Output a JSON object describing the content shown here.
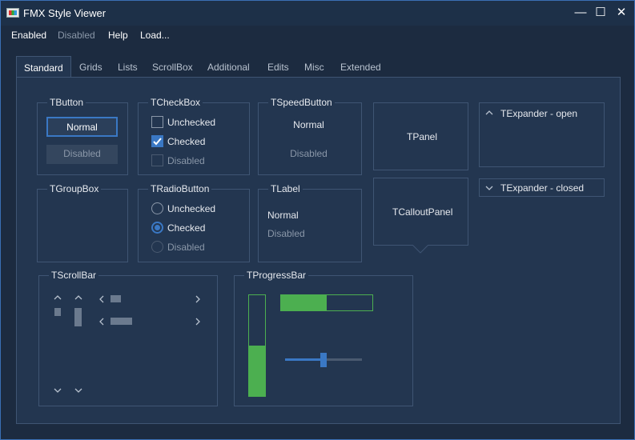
{
  "window": {
    "title": "FMX Style Viewer",
    "minimize": "—",
    "maximize": "☐",
    "close": "✕"
  },
  "menu": {
    "enabled": "Enabled",
    "disabled": "Disabled",
    "help": "Help",
    "load": "Load..."
  },
  "tabs": [
    "Standard",
    "Grids",
    "Lists",
    "ScrollBox",
    "Additional",
    "Edits",
    "Misc",
    "Extended"
  ],
  "active_tab": "Standard",
  "tbutton": {
    "title": "TButton",
    "normal": "Normal",
    "disabled": "Disabled"
  },
  "tcheckbox": {
    "title": "TCheckBox",
    "unchecked": "Unchecked",
    "checked": "Checked",
    "disabled": "Disabled"
  },
  "tspeedbutton": {
    "title": "TSpeedButton",
    "normal": "Normal",
    "disabled": "Disabled"
  },
  "tpanel": {
    "label": "TPanel"
  },
  "texpander_open": {
    "label": "TExpander - open"
  },
  "texpander_closed": {
    "label": "TExpander - closed"
  },
  "tgroupbox": {
    "title": "TGroupBox"
  },
  "tradiobutton": {
    "title": "TRadioButton",
    "unchecked": "Unchecked",
    "checked": "Checked",
    "disabled": "Disabled"
  },
  "tlabel": {
    "title": "TLabel",
    "normal": "Normal",
    "disabled": "Disabled"
  },
  "tcalloutpanel": {
    "label": "TCalloutPanel"
  },
  "tscrollbar": {
    "title": "TScrollBar"
  },
  "tprogressbar": {
    "title": "TProgressBar",
    "vertical_value": 0.5,
    "horizontal_value": 0.5,
    "slider_value": 0.5
  },
  "colors": {
    "accent": "#3a78c4",
    "progress": "#4caf50",
    "background": "#233650"
  }
}
